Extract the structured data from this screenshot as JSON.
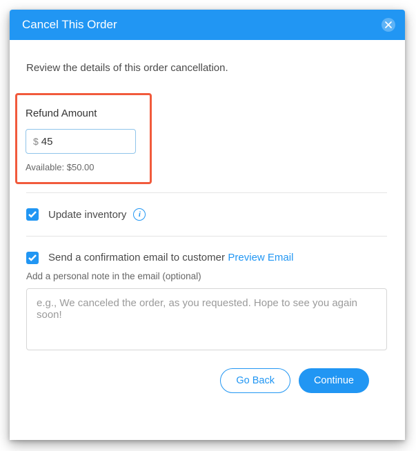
{
  "header": {
    "title": "Cancel This Order"
  },
  "intro": "Review the details of this order cancellation.",
  "refund": {
    "label": "Refund Amount",
    "currency": "$",
    "value": "45",
    "available": "Available: $50.00"
  },
  "inventory": {
    "label": "Update inventory"
  },
  "email": {
    "label": "Send a confirmation email to customer",
    "preview_link": "Preview Email",
    "note_label": "Add a personal note in the email (optional)",
    "note_placeholder": "e.g., We canceled the order, as you requested. Hope to see you again soon!"
  },
  "footer": {
    "go_back": "Go Back",
    "continue": "Continue"
  }
}
